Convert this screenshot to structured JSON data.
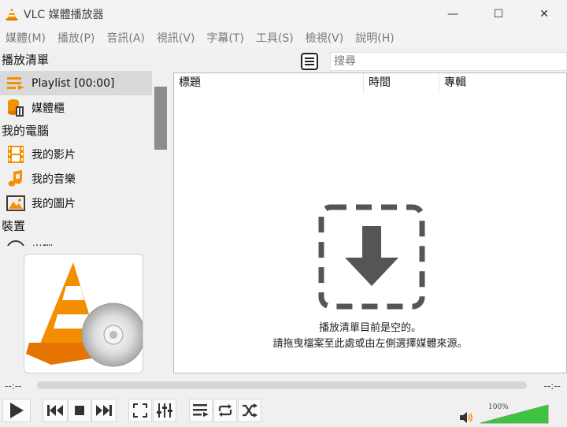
{
  "window": {
    "title": "VLC 媒體播放器",
    "controls": [
      "—",
      "☐",
      "✕"
    ]
  },
  "menu": [
    "媒體(M)",
    "播放(P)",
    "音訊(A)",
    "視訊(V)",
    "字幕(T)",
    "工具(S)",
    "檢視(V)",
    "說明(H)"
  ],
  "sidebar": {
    "playlist_section": "播放清單",
    "playlist_item": "Playlist [00:00]",
    "library_item": "媒體櫃",
    "computer_section": "我的電腦",
    "videos_item": "我的影片",
    "music_item": "我的音樂",
    "pictures_item": "我的圖片",
    "devices_section": "裝置",
    "disc_item": "光碟"
  },
  "search": {
    "placeholder": "搜尋"
  },
  "playlist": {
    "columns": [
      "標題",
      "時間",
      "專輯"
    ],
    "empty_line1": "播放清單目前是空的。",
    "empty_line2": "請拖曳檔案至此處或由左側選擇媒體來源。"
  },
  "seek": {
    "elapsed": "--:--",
    "remaining": "--:--",
    "progress": 0
  },
  "volume": {
    "label": "100%",
    "level": 1.0
  },
  "colors": {
    "accent_orange": "#f39200",
    "icon_gray": "#3c3c3c",
    "volume_green": "#3cc43c"
  }
}
